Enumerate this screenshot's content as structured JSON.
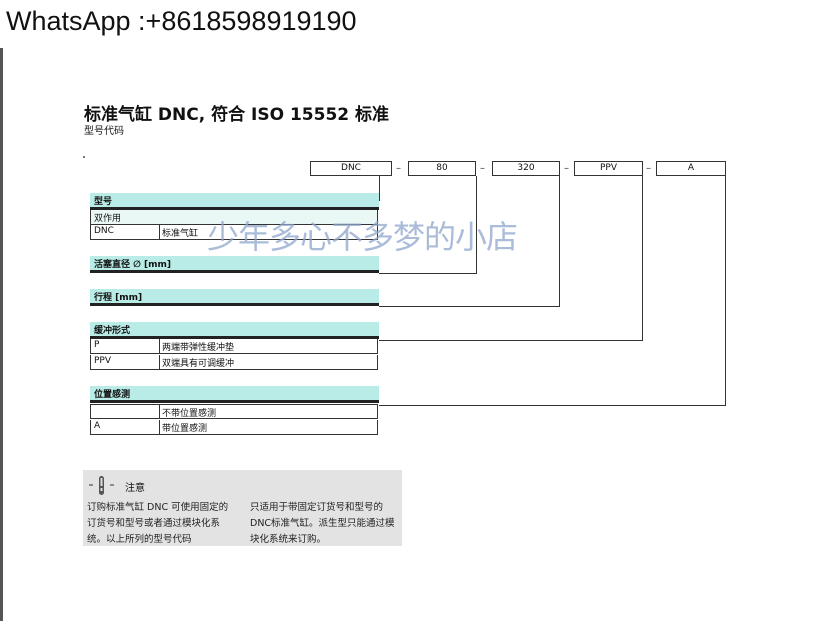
{
  "watermark_contact": "WhatsApp :+8618598919190",
  "watermark_shop": "少年多心不多梦的小店",
  "header": {
    "title": "标准气缸 DNC, 符合 ISO 15552 标准",
    "subtitle": "型号代码"
  },
  "code": [
    "DNC",
    "80",
    "320",
    "PPV",
    "A"
  ],
  "code_separator": "–",
  "sections": {
    "type": {
      "title": "型号",
      "rows": [
        {
          "code": "双作用",
          "desc": ""
        },
        {
          "code": "DNC",
          "desc": "标准气缸"
        }
      ]
    },
    "bore": {
      "title": "活塞直径 ∅ [mm]"
    },
    "stroke": {
      "title": "行程 [mm]"
    },
    "cushion": {
      "title": "缓冲形式",
      "rows": [
        {
          "code": "P",
          "desc": "两端带弹性缓冲垫"
        },
        {
          "code": "PPV",
          "desc": "双端具有可调缓冲"
        }
      ]
    },
    "sensing": {
      "title": "位置感测",
      "rows": [
        {
          "code": "",
          "desc": "不带位置感测"
        },
        {
          "code": "A",
          "desc": "带位置感测"
        }
      ]
    }
  },
  "note": {
    "label": "注意",
    "left": "订购标准气缸 DNC 可使用固定的订货号和型号或者通过模块化系统。以上所列的型号代码",
    "right": "只适用于带固定订货号和型号的DNC标准气缸。派生型只能通过模块化系统来订购。"
  },
  "colors": {
    "section_fill": "#b9ece6",
    "note_bg": "#e3e3e3",
    "watermark": "#8fa6cc"
  }
}
